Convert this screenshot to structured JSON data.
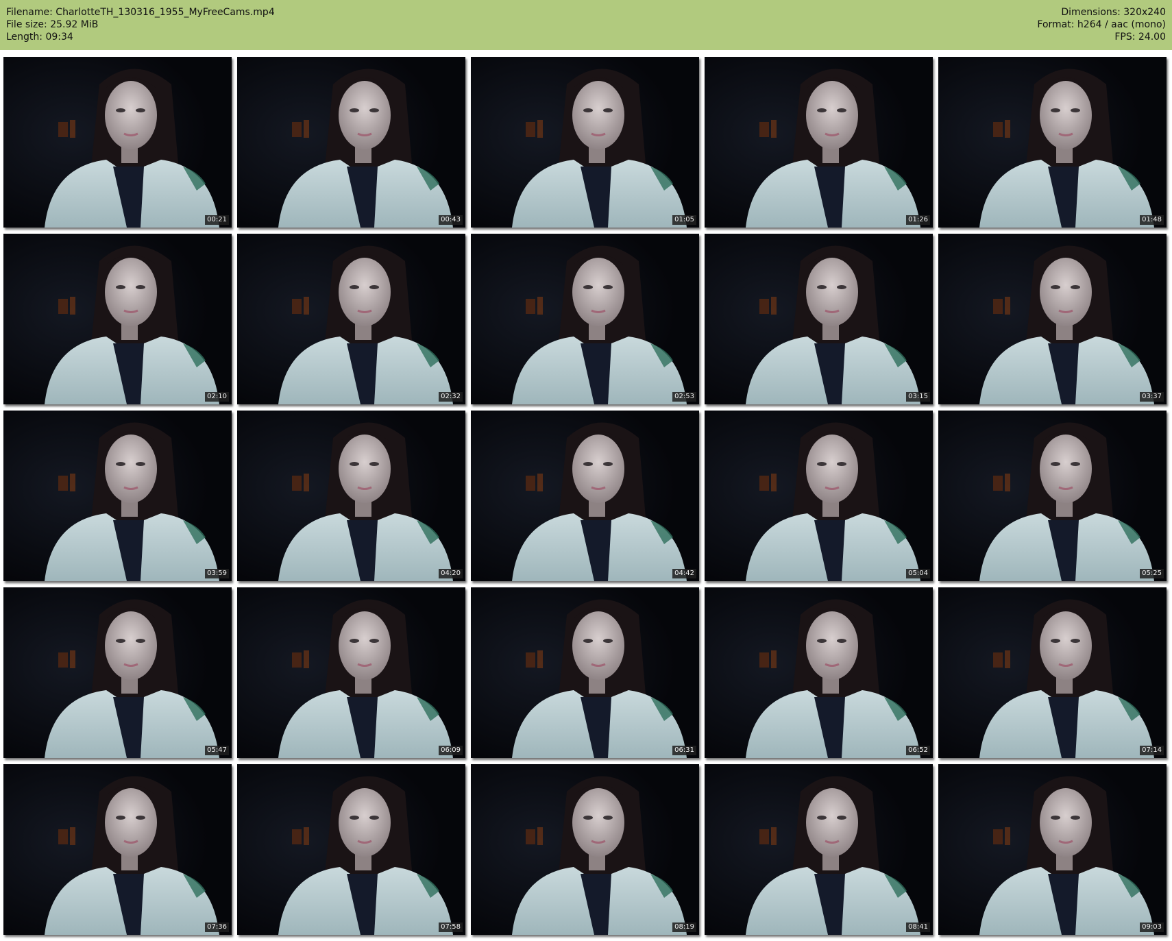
{
  "header": {
    "filename": "Filename: CharlotteTH_130316_1955_MyFreeCams.mp4",
    "filesize": "File size: 25.92 MiB",
    "length": "Length: 09:34",
    "dimensions": "Dimensions: 320x240",
    "format": "Format: h264 / aac (mono)",
    "fps": "FPS: 24.00"
  },
  "colors": {
    "header_bg": "#b1ca7e",
    "frame_bg": "#07080b"
  },
  "thumbnails": [
    {
      "timestamp": "00:21"
    },
    {
      "timestamp": "00:43"
    },
    {
      "timestamp": "01:05"
    },
    {
      "timestamp": "01:26"
    },
    {
      "timestamp": "01:48"
    },
    {
      "timestamp": "02:10"
    },
    {
      "timestamp": "02:32"
    },
    {
      "timestamp": "02:53"
    },
    {
      "timestamp": "03:15"
    },
    {
      "timestamp": "03:37"
    },
    {
      "timestamp": "03:59"
    },
    {
      "timestamp": "04:20"
    },
    {
      "timestamp": "04:42"
    },
    {
      "timestamp": "05:04"
    },
    {
      "timestamp": "05:25"
    },
    {
      "timestamp": "05:47"
    },
    {
      "timestamp": "06:09"
    },
    {
      "timestamp": "06:31"
    },
    {
      "timestamp": "06:52"
    },
    {
      "timestamp": "07:14"
    },
    {
      "timestamp": "07:36"
    },
    {
      "timestamp": "07:58"
    },
    {
      "timestamp": "08:19"
    },
    {
      "timestamp": "08:41"
    },
    {
      "timestamp": "09:03"
    }
  ]
}
